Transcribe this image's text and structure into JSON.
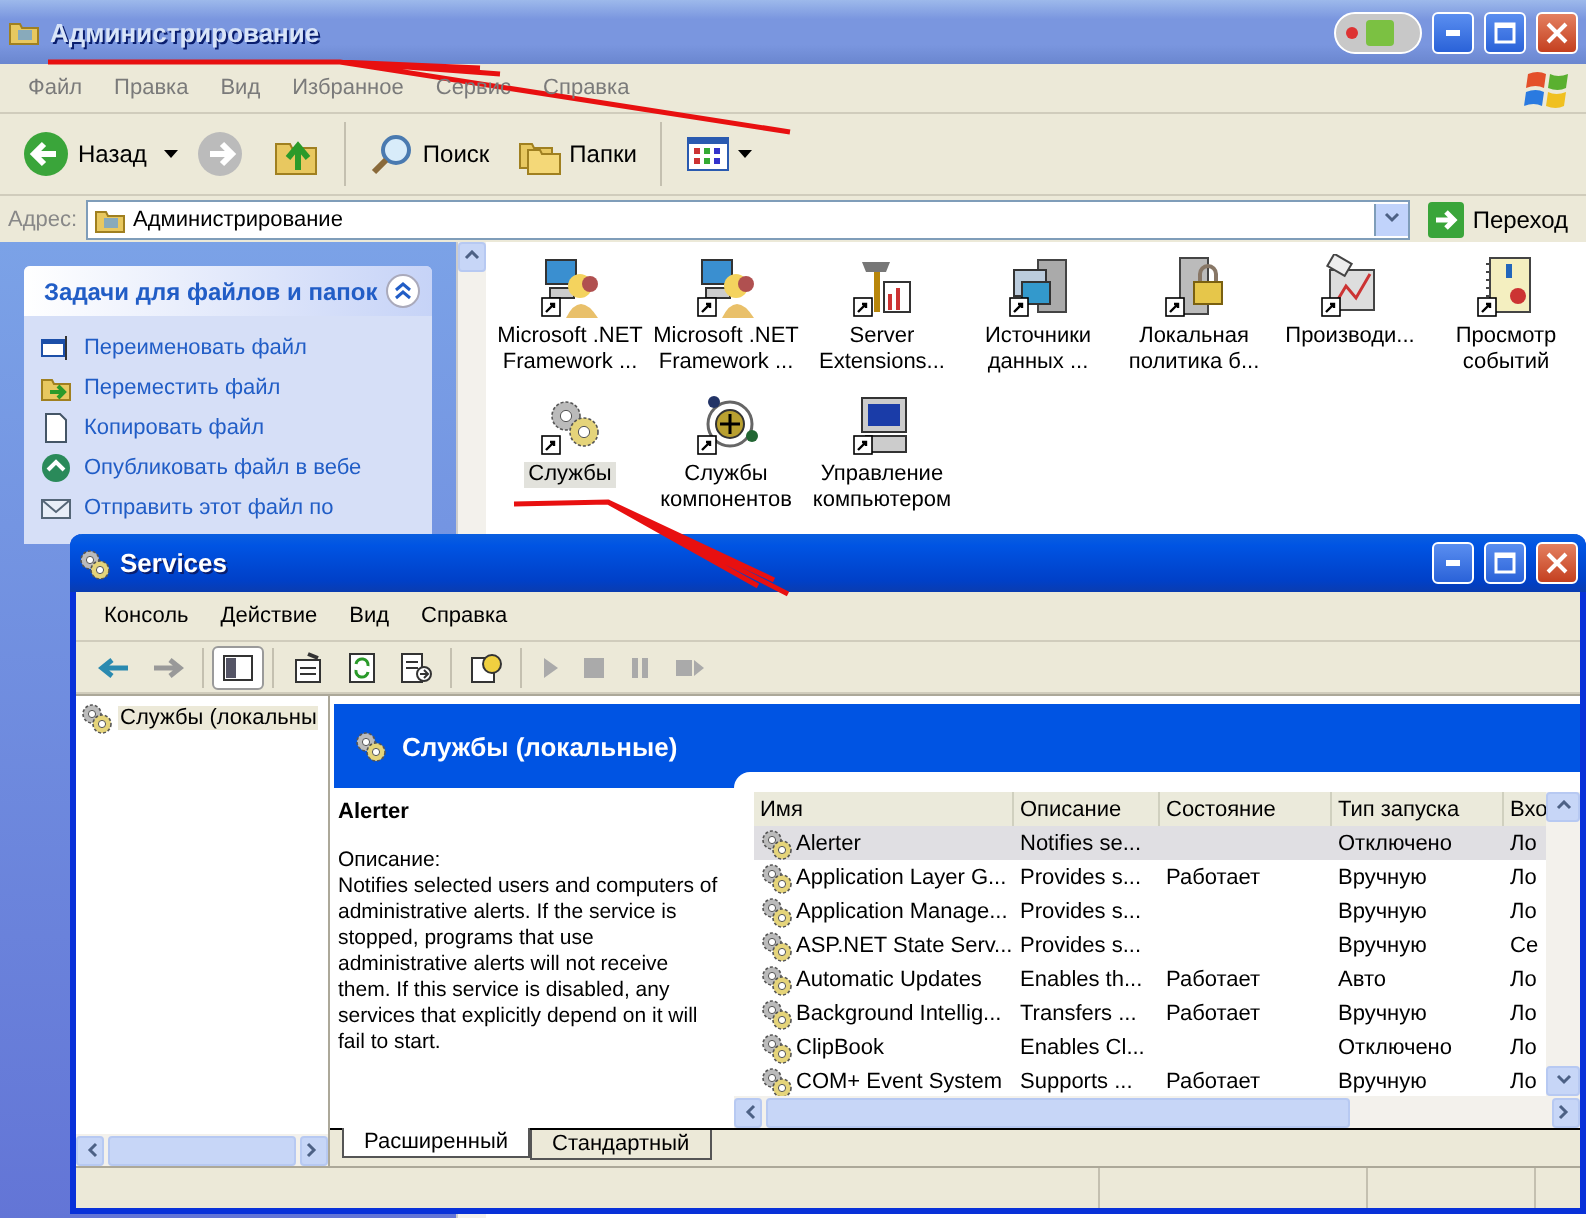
{
  "explorer": {
    "title": "Администрирование",
    "menu": [
      "Файл",
      "Правка",
      "Вид",
      "Избранное",
      "Сервис",
      "Справка"
    ],
    "toolbar": {
      "back": "Назад",
      "search": "Поиск",
      "folders": "Папки"
    },
    "address": {
      "label": "Адрес:",
      "value": "Администрирование",
      "go": "Переход"
    },
    "task_pane": {
      "title": "Задачи для файлов и папок",
      "expanded": true,
      "tasks": [
        {
          "label": "Переименовать файл",
          "kind": "rename"
        },
        {
          "label": "Переместить файл",
          "kind": "move"
        },
        {
          "label": "Копировать файл",
          "kind": "copy"
        },
        {
          "label": "Опубликовать файл в вебе",
          "kind": "publish"
        },
        {
          "label": "Отправить этот файл по",
          "kind": "email"
        }
      ]
    },
    "items": [
      {
        "lines": [
          "Microsoft .NET",
          "Framework ..."
        ],
        "kind": "person",
        "selected": false
      },
      {
        "lines": [
          "Microsoft .NET",
          "Framework ..."
        ],
        "kind": "person",
        "selected": false
      },
      {
        "lines": [
          "Server",
          "Extensions..."
        ],
        "kind": "tools",
        "selected": false
      },
      {
        "lines": [
          "Источники",
          "данных ..."
        ],
        "kind": "server",
        "selected": false
      },
      {
        "lines": [
          "Локальная",
          "политика б..."
        ],
        "kind": "lock",
        "selected": false
      },
      {
        "lines": [
          "Производи..."
        ],
        "kind": "chart",
        "selected": false
      },
      {
        "lines": [
          "Просмотр",
          "событий"
        ],
        "kind": "book",
        "selected": false
      },
      {
        "lines": [
          "Службы"
        ],
        "kind": "gears",
        "selected": true
      },
      {
        "lines": [
          "Службы",
          "компонентов"
        ],
        "kind": "orbit",
        "selected": false
      },
      {
        "lines": [
          "Управление",
          "компьютером"
        ],
        "kind": "computer",
        "selected": false
      }
    ]
  },
  "services": {
    "title": "Services",
    "menu": [
      "Консоль",
      "Действие",
      "Вид",
      "Справка"
    ],
    "tree": [
      {
        "label": "Службы (локальны",
        "selected": true
      }
    ],
    "header": "Службы (локальные)",
    "detail": {
      "name": "Alerter",
      "caption": "Описание:",
      "text": "Notifies selected users and computers of administrative alerts. If the service is stopped, programs that use administrative alerts will not receive them. If this service is disabled, any services that explicitly depend on it will fail to start."
    },
    "columns": [
      "Имя",
      "Описание",
      "Состояние",
      "Тип запуска",
      "Вхо"
    ],
    "rows": [
      {
        "cells": [
          "Alerter",
          "Notifies se...",
          "",
          "Отключено",
          "Ло"
        ],
        "selected": true
      },
      {
        "cells": [
          "Application Layer G...",
          "Provides s...",
          "Работает",
          "Вручную",
          "Ло"
        ],
        "selected": false
      },
      {
        "cells": [
          "Application Manage...",
          "Provides s...",
          "",
          "Вручную",
          "Ло"
        ],
        "selected": false
      },
      {
        "cells": [
          "ASP.NET State Serv...",
          "Provides s...",
          "",
          "Вручную",
          "Се"
        ],
        "selected": false
      },
      {
        "cells": [
          "Automatic Updates",
          "Enables th...",
          "Работает",
          "Авто",
          "Ло"
        ],
        "selected": false
      },
      {
        "cells": [
          "Background Intellig...",
          "Transfers ...",
          "Работает",
          "Вручную",
          "Ло"
        ],
        "selected": false
      },
      {
        "cells": [
          "ClipBook",
          "Enables Cl...",
          "",
          "Отключено",
          "Ло"
        ],
        "selected": false
      },
      {
        "cells": [
          "COM+ Event System",
          "Supports ...",
          "Работает",
          "Вручную",
          "Ло"
        ],
        "selected": false
      }
    ],
    "tabs": [
      {
        "label": "Расширенный",
        "selected": true
      },
      {
        "label": "Стандартный",
        "selected": false
      }
    ]
  }
}
